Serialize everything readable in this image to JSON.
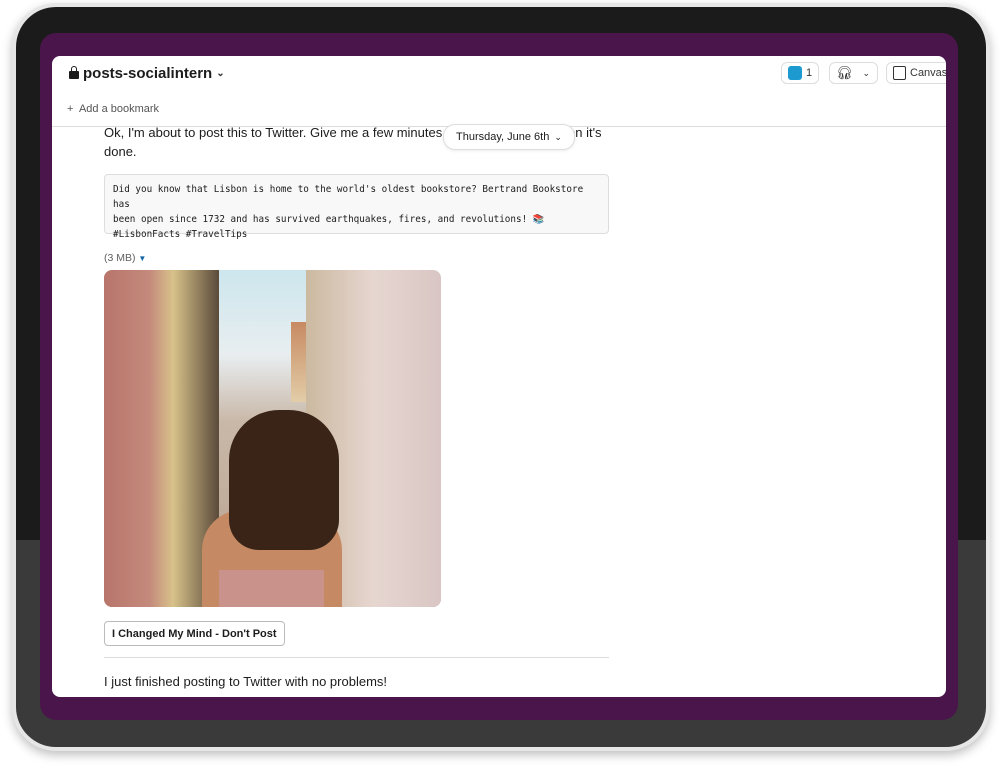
{
  "channel": {
    "name": "posts-socialintern",
    "private": true
  },
  "header": {
    "members_count": "1",
    "canvas_label": "Canvas",
    "add_bookmark": "Add a bookmark"
  },
  "date_divider": {
    "label": "Thursday, June 6th"
  },
  "messages": [
    {
      "text_visible_start": "Ok, I'm about to post this to Twitter. Give me a few minutes a",
      "text_visible_end": "en it's",
      "text_line2": "done."
    },
    {
      "text": "I just finished posting to Twitter with no problems!"
    }
  ],
  "code_block": "Did you know that Lisbon is home to the world's oldest bookstore? Bertrand Bookstore has\nbeen open since 1732 and has survived earthquakes, fires, and revolutions! 📚\n#LisbonFacts #TravelTips",
  "attachment": {
    "size": "(3 MB)"
  },
  "action_button": "I Changed My Mind - Don't Post",
  "colors": {
    "frame": "#4a154b",
    "link": "#1264a3"
  }
}
